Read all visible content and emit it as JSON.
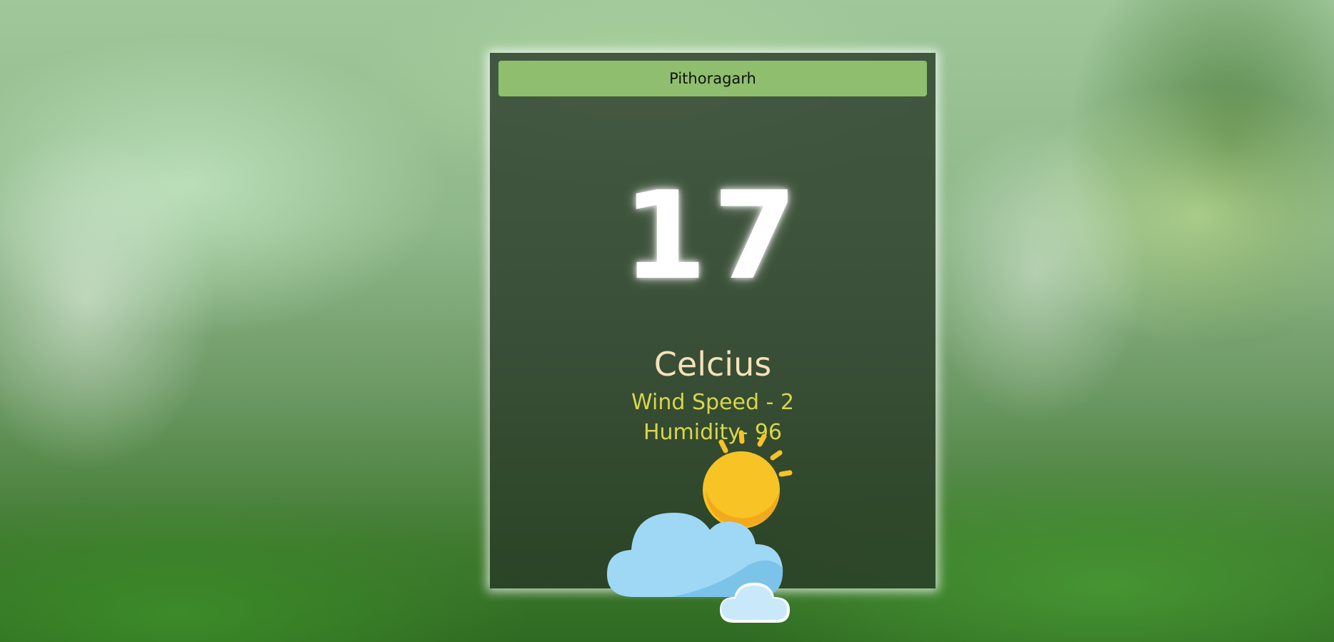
{
  "city": {
    "value": "Pithoragarh"
  },
  "weather": {
    "temperature": "17",
    "unit": "Celcius",
    "wind_speed": "Wind Speed - 2",
    "humidity": "Humidity- 96",
    "icon": "partly-cloudy-icon"
  },
  "colors": {
    "input_background": "#8fbf6e",
    "card_background": "#28372680",
    "unit_text": "#f6e1b8",
    "details_text": "#d8d64a",
    "sun": "#f7c325",
    "cloud": "#9fd8f5"
  }
}
